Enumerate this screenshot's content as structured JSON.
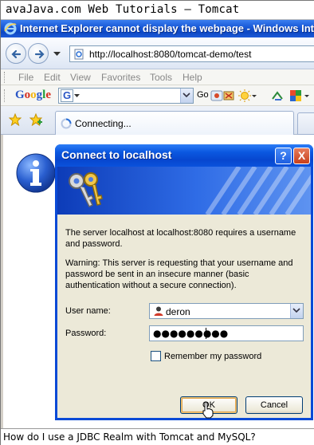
{
  "caption_top": "avaJava.com Web Tutorials – Tomcat",
  "ie_window": {
    "title": "Internet Explorer cannot display the webpage - Windows Int",
    "address": "http://localhost:8080/tomcat-demo/test"
  },
  "menu": [
    "File",
    "Edit",
    "View",
    "Favorites",
    "Tools",
    "Help"
  ],
  "google_toolbar": {
    "logo": [
      "G",
      "o",
      "o",
      "g",
      "l",
      "e"
    ],
    "logo_colors": [
      "#2a56c6",
      "#d62e1f",
      "#f2b50f",
      "#2a56c6",
      "#1e9d3a",
      "#d62e1f"
    ],
    "engine_letter": "G",
    "go_label": "Go"
  },
  "tab": {
    "label": "Connecting..."
  },
  "dialog": {
    "title": "Connect to localhost",
    "help_label": "?",
    "close_label": "X",
    "message": "The server localhost at localhost:8080 requires a username and password.",
    "warning": "Warning: This server is requesting that your username and password be sent in an insecure manner (basic authentication without a secure connection).",
    "username_label": "User name:",
    "username_value": "deron",
    "password_label": "Password:",
    "password_value": "●●●●●●●●●",
    "remember_label": "Remember my password",
    "remember_checked": false,
    "ok_label": "OK",
    "cancel_label": "Cancel"
  },
  "caption_bottom": "How do I use a JDBC Realm with Tomcat and MySQL?",
  "colors": {
    "xp_title_blue": "#0b58e0",
    "dialog_face": "#ece9d8",
    "close_red": "#c8401c"
  }
}
